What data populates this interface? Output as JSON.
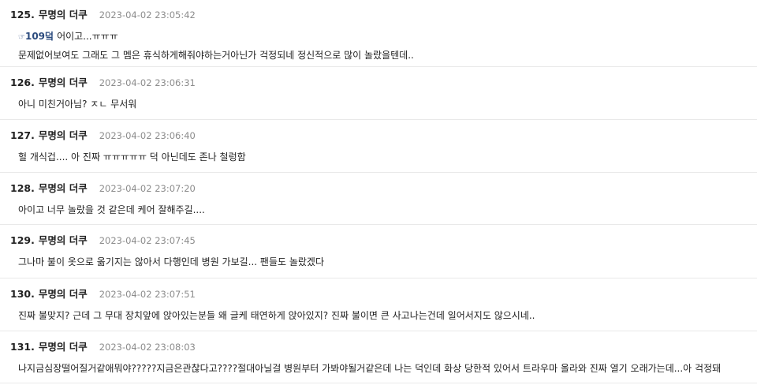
{
  "comments": [
    {
      "number": "125.",
      "author": "무명의 더쿠",
      "timestamp": "2023-04-02 23:05:42",
      "reply_hand": "☞",
      "reply_to": "109덬",
      "reply_text": "어이고...ㅠㅠㅠ",
      "text": "문제없어보여도 그래도 그 멤은 휴식하게해줘야하는거아닌가 걱정되네 정신적으로 많이 놀랐을텐데.."
    },
    {
      "number": "126.",
      "author": "무명의 더쿠",
      "timestamp": "2023-04-02 23:06:31",
      "text": "아니 미친거아님? ㅈㄴ 무서워"
    },
    {
      "number": "127.",
      "author": "무명의 더쿠",
      "timestamp": "2023-04-02 23:06:40",
      "text": "헐 개식겁.... 아 진짜 ㅠㅠㅠㅠㅠ 덕 아닌데도 존나 철렁함"
    },
    {
      "number": "128.",
      "author": "무명의 더쿠",
      "timestamp": "2023-04-02 23:07:20",
      "text": "아이고 너무 놀랐을 것 같은데 케어 잘해주길...."
    },
    {
      "number": "129.",
      "author": "무명의 더쿠",
      "timestamp": "2023-04-02 23:07:45",
      "text": "그나마 불이 옷으로 옮기지는 않아서 다행인데 병원 가보길... 팬들도 놀랐겠다"
    },
    {
      "number": "130.",
      "author": "무명의 더쿠",
      "timestamp": "2023-04-02 23:07:51",
      "text": "진짜 불맞지? 근데 그 무대 장치앞에 앉아있는분들 왜 글케 태연하게 앉아있지? 진짜 불이면 큰 사고나는건데 일어서지도 않으시네.."
    },
    {
      "number": "131.",
      "author": "무명의 더쿠",
      "timestamp": "2023-04-02 23:08:03",
      "text": "나지금심장떨어질거같애뭐야?????지금은관찮다고????절대아닐걸 병원부터 가봐야될거같은데 나는 덕인데 화상 당한적 있어서 트라우마 올라와 진짜 열기 오래가는데...아 걱정돼"
    }
  ]
}
